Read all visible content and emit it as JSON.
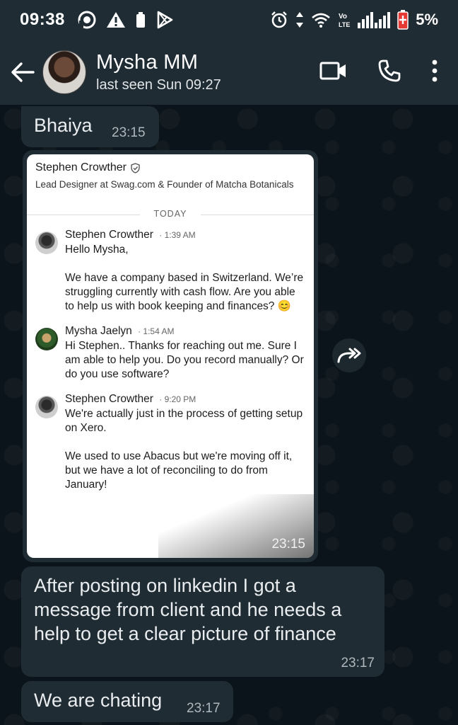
{
  "status_bar": {
    "time": "09:38",
    "battery_pct": "5%",
    "network": "LTE"
  },
  "header": {
    "name": "Mysha MM",
    "last_seen": "last seen Sun 09:27"
  },
  "messages": [
    {
      "text": "Bhaiya",
      "time": "23:15"
    },
    {
      "text": "After posting on linkedin I got a message from client and he needs a help to get a clear picture of finance",
      "time": "23:17"
    },
    {
      "text": "We are chating",
      "time": "23:17"
    }
  ],
  "image_message": {
    "time": "23:15",
    "profile_name": "Stephen Crowther",
    "profile_title": "Lead Designer at Swag.com & Founder of Matcha Botanicals",
    "divider": "TODAY",
    "thread": [
      {
        "author": "Stephen Crowther",
        "time": "1:39 AM",
        "body": "Hello Mysha,\n\nWe have a company based in Switzerland. We’re struggling currently with cash flow. Are you able to help us with book keeping and finances? 😊"
      },
      {
        "author": "Mysha Jaelyn",
        "time": "1:54 AM",
        "body": "Hi Stephen.. Thanks for reaching out me. Sure I am able to help you. Do you record manually? Or do you use software?"
      },
      {
        "author": "Stephen Crowther",
        "time": "9:20 PM",
        "body": "We're actually just in the process of getting setup on Xero.\n\nWe used to use Abacus but we're moving off it, but we have a lot of reconciling to do from January!"
      }
    ]
  },
  "colors": {
    "app_bar": "#1f2c34",
    "background": "#0b141a",
    "bubble": "#202c33",
    "battery_low": "#e53935"
  }
}
